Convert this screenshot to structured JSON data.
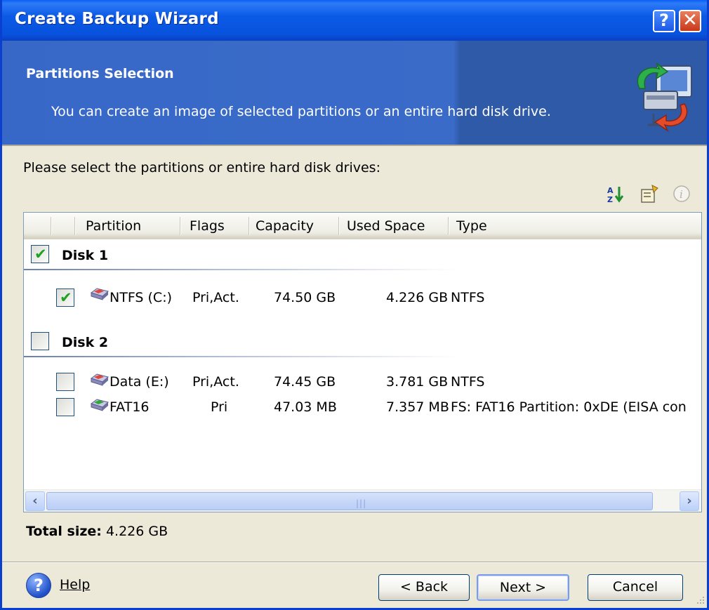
{
  "window": {
    "title": "Create Backup Wizard",
    "help_button": "?",
    "close_button": "✕"
  },
  "banner": {
    "title": "Partitions Selection",
    "subtitle": "You can create an image of selected partitions or an entire hard disk drive."
  },
  "instructions": "Please select the partitions or entire hard disk drives:",
  "toolbar": {
    "icons": [
      "sort-icon",
      "properties-icon",
      "info-icon"
    ]
  },
  "table": {
    "columns": [
      "Partition",
      "Flags",
      "Capacity",
      "Used Space",
      "Type"
    ],
    "disks": [
      {
        "label": "Disk 1",
        "checked": true,
        "partitions": [
          {
            "name": "NTFS (C:)",
            "flags": "Pri,Act.",
            "capacity": "74.50 GB",
            "used": "4.226 GB",
            "type": "NTFS",
            "checked": true
          }
        ]
      },
      {
        "label": "Disk 2",
        "checked": false,
        "partitions": [
          {
            "name": "Data (E:)",
            "flags": "Pri,Act.",
            "capacity": "74.45 GB",
            "used": "3.781 GB",
            "type": "NTFS",
            "checked": false
          },
          {
            "name": "FAT16",
            "flags": "Pri",
            "capacity": "47.03 MB",
            "used": "7.357 MB",
            "type": "FS: FAT16 Partition: 0xDE (EISA con",
            "checked": false
          }
        ]
      }
    ]
  },
  "total": {
    "label": "Total size:",
    "value": "4.226 GB"
  },
  "footer": {
    "help": "Help",
    "back": "< Back",
    "next": "Next >",
    "cancel": "Cancel"
  },
  "colors": {
    "titlebar": "#0a5ef4",
    "banner": "#3768c8",
    "checkmark": "#21a121",
    "window_bg": "#ece9d8"
  }
}
